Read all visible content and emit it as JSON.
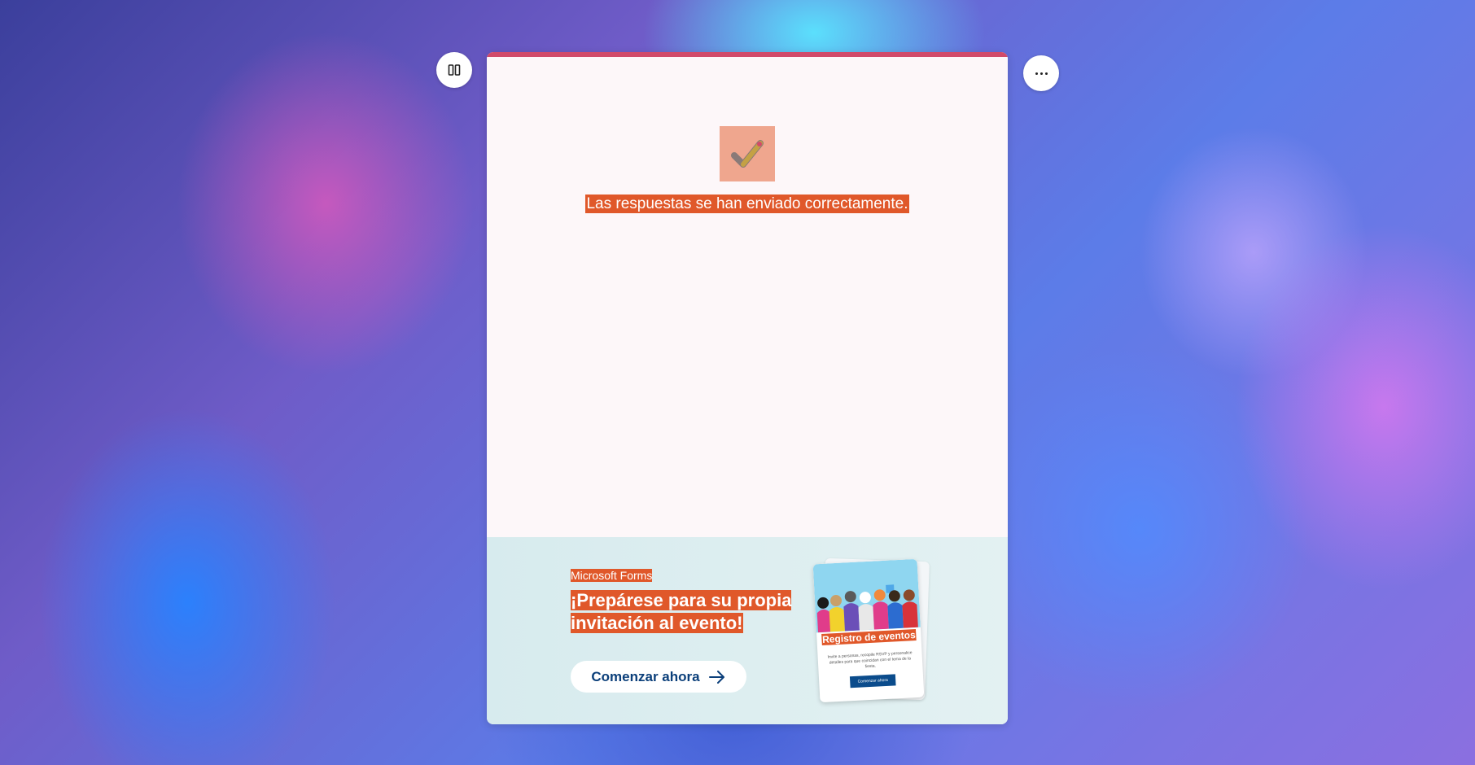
{
  "header": {
    "left_button_icon": "immersive-reader-icon",
    "right_button_icon": "more-options-icon"
  },
  "confirmation": {
    "icon": "checkmark-icon",
    "message": "Las respuestas se han enviado correctamente."
  },
  "promo": {
    "brand": "Microsoft Forms",
    "title": "¡Prepárese para su propia invitación al evento!",
    "cta_label": "Comenzar ahora",
    "cta_icon": "arrow-right-icon",
    "preview": {
      "title": "Registro de eventos",
      "text": "Invite a personas, recopile RSVP y personalice detalles para que coincidan con el tema de la fiesta.",
      "button_label": "Comenzar ahora"
    }
  },
  "colors": {
    "accent_bar": "#d14a6a",
    "highlight": "#e0582a",
    "cta_text": "#0b3f7a"
  }
}
